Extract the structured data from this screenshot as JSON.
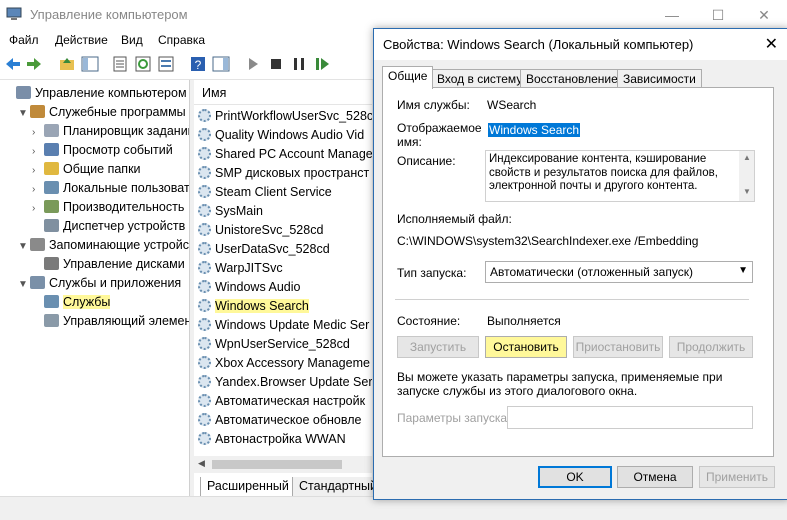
{
  "window": {
    "title": "Управление компьютером",
    "controls": [
      "—",
      "☐",
      "✕"
    ]
  },
  "menu": [
    "Файл",
    "Действие",
    "Вид",
    "Справка"
  ],
  "tree": {
    "items": [
      {
        "label": "Управление компьютером (л",
        "level": 0,
        "arrow": "",
        "icon": "computer-icon",
        "color": "#7a8ea8"
      },
      {
        "label": "Служебные программы",
        "level": 1,
        "arrow": "▼",
        "icon": "tools-icon",
        "color": "#c08a3a"
      },
      {
        "label": "Планировщик заданий",
        "level": 2,
        "arrow": "›",
        "icon": "clock-icon",
        "color": "#9aa5b5"
      },
      {
        "label": "Просмотр событий",
        "level": 2,
        "arrow": "›",
        "icon": "event-viewer-icon",
        "color": "#5a7fb0"
      },
      {
        "label": "Общие папки",
        "level": 2,
        "arrow": "›",
        "icon": "shared-folder-icon",
        "color": "#e0b840"
      },
      {
        "label": "Локальные пользовате",
        "level": 2,
        "arrow": "›",
        "icon": "users-icon",
        "color": "#6a8fb0"
      },
      {
        "label": "Производительность",
        "level": 2,
        "arrow": "›",
        "icon": "performance-icon",
        "color": "#7a9a5a"
      },
      {
        "label": "Диспетчер устройств",
        "level": 2,
        "arrow": "",
        "icon": "device-manager-icon",
        "color": "#8090a0"
      },
      {
        "label": "Запоминающие устройст",
        "level": 1,
        "arrow": "▼",
        "icon": "storage-icon",
        "color": "#8a8a8a"
      },
      {
        "label": "Управление дисками",
        "level": 2,
        "arrow": "",
        "icon": "disk-icon",
        "color": "#7a7a7a"
      },
      {
        "label": "Службы и приложения",
        "level": 1,
        "arrow": "▼",
        "icon": "services-apps-icon",
        "color": "#7a90a8"
      },
      {
        "label": "Службы",
        "level": 2,
        "arrow": "",
        "icon": "gear-icon",
        "color": "#6a8fb0",
        "highlight": true
      },
      {
        "label": "Управляющий элемен",
        "level": 2,
        "arrow": "",
        "icon": "wmi-icon",
        "color": "#8a9aa8"
      }
    ]
  },
  "list": {
    "header": "Имя",
    "items": [
      "PrintWorkflowUserSvc_528cd",
      "Quality Windows Audio Vid",
      "Shared PC Account Manager",
      "SMP дисковых пространст",
      "Steam Client Service",
      "SysMain",
      "UnistoreSvc_528cd",
      "UserDataSvc_528cd",
      "WarpJITSvc",
      "Windows Audio",
      "Windows Search",
      "Windows Update Medic Ser",
      "WpnUserService_528cd",
      "Xbox Accessory Manageme",
      "Yandex.Browser Update Ser",
      "Автоматическая настройк",
      "Автоматическое обновле",
      "Автонастройка WWAN"
    ],
    "highlighted_index": 10
  },
  "bottom_tabs": [
    "Расширенный",
    "Стандартный"
  ],
  "dialog": {
    "title": "Свойства: Windows Search (Локальный компьютер)",
    "tabs": [
      "Общие",
      "Вход в систему",
      "Восстановление",
      "Зависимости"
    ],
    "service_name_label": "Имя службы:",
    "service_name": "WSearch",
    "display_name_label_1": "Отображаемое",
    "display_name_label_2": "имя:",
    "display_name": "Windows Search",
    "description_label": "Описание:",
    "description": "Индексирование контента, кэширование свойств и результатов поиска для файлов, электронной почты и другого контента.",
    "exe_label": "Исполняемый файл:",
    "exe_path": "C:\\WINDOWS\\system32\\SearchIndexer.exe /Embedding",
    "startup_type_label": "Тип запуска:",
    "startup_type": "Автоматически (отложенный запуск)",
    "status_label": "Состояние:",
    "status": "Выполняется",
    "btn_start": "Запустить",
    "btn_stop": "Остановить",
    "btn_pause": "Приостановить",
    "btn_resume": "Продолжить",
    "hint": "Вы можете указать параметры запуска, применяемые при запуске службы из этого диалогового окна.",
    "params_label": "Параметры запуска:",
    "params_value": "",
    "btn_ok": "OK",
    "btn_cancel": "Отмена",
    "btn_apply": "Применить"
  }
}
